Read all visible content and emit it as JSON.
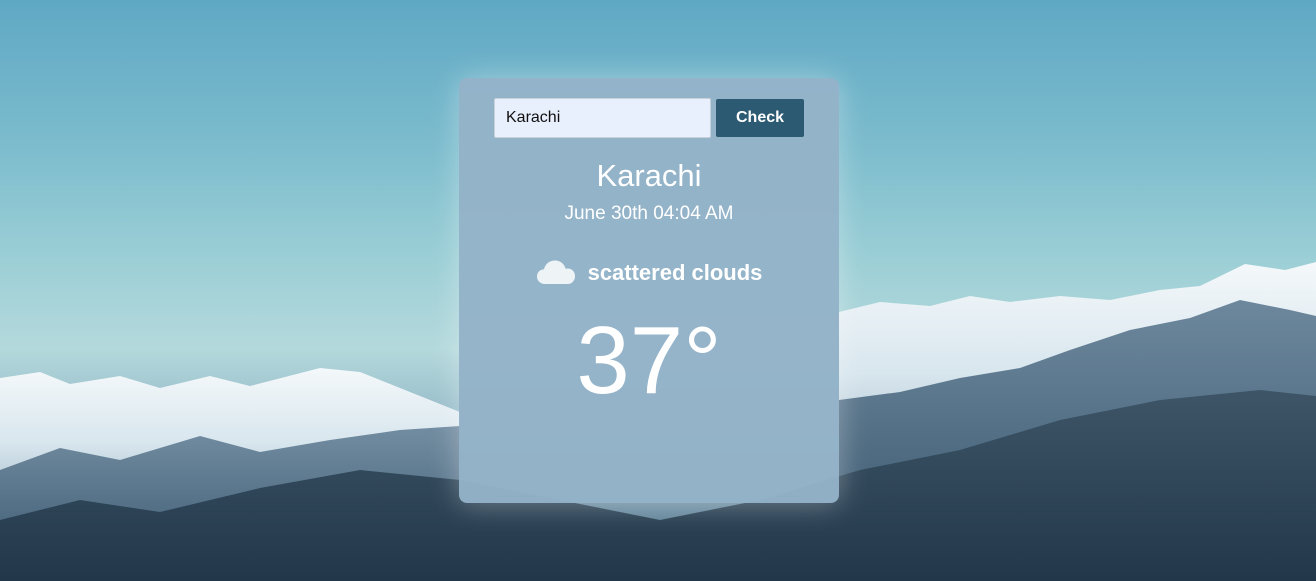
{
  "search": {
    "value": "Karachi",
    "button_label": "Check"
  },
  "weather": {
    "city": "Karachi",
    "datetime": "June 30th 04:04 AM",
    "condition": "scattered clouds",
    "condition_icon": "cloud-icon",
    "temperature": "37°"
  },
  "colors": {
    "button": "#2c5a72",
    "card": "#94b3c8",
    "input": "#e8effd"
  }
}
